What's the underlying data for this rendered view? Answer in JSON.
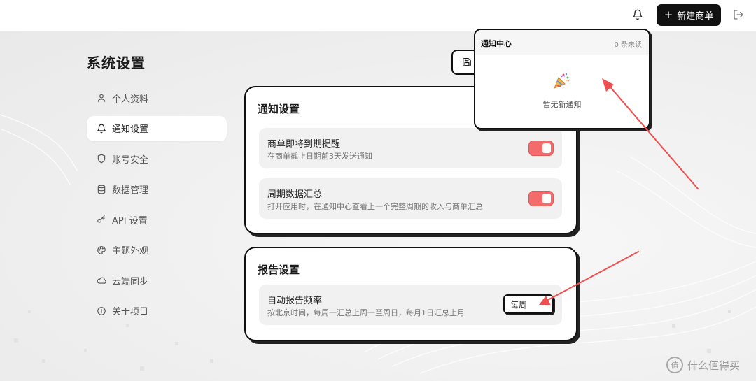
{
  "header": {
    "new_button_label": "新建商单",
    "new_button_icon": "plus-icon",
    "bell_icon": "bell-icon",
    "logout_icon": "logout-icon"
  },
  "page": {
    "title": "系统设置"
  },
  "sidebar": {
    "items": [
      {
        "label": "个人资料",
        "icon": "user-icon",
        "active": false
      },
      {
        "label": "通知设置",
        "icon": "bell-icon",
        "active": true
      },
      {
        "label": "账号安全",
        "icon": "shield-icon",
        "active": false
      },
      {
        "label": "数据管理",
        "icon": "database-icon",
        "active": false
      },
      {
        "label": "API 设置",
        "icon": "key-icon",
        "active": false
      },
      {
        "label": "主题外观",
        "icon": "palette-icon",
        "active": false
      },
      {
        "label": "云端同步",
        "icon": "cloud-icon",
        "active": false
      },
      {
        "label": "关于项目",
        "icon": "info-icon",
        "active": false
      }
    ]
  },
  "notification_card": {
    "title": "通知设置",
    "rows": [
      {
        "title": "商单即将到期提醒",
        "description": "在商单截止日期前3天发送通知",
        "enabled": true
      },
      {
        "title": "周期数据汇总",
        "description": "打开应用时，在通知中心查看上一个完整周期的收入与商单汇总",
        "enabled": true
      }
    ]
  },
  "report_card": {
    "title": "报告设置",
    "rows": [
      {
        "title": "自动报告频率",
        "description": "按北京时间，每周一汇总上周一至周日，每月1日汇总上月",
        "selected": "每周"
      }
    ]
  },
  "notification_popup": {
    "title": "通知中心",
    "unread_count": "0 条未读",
    "empty_icon": "party-popper-icon",
    "empty_text": "暂无新通知"
  },
  "watermark": {
    "text": "什么值得买",
    "logo_char": "值"
  },
  "colors": {
    "accent": "#f36b6b",
    "annotation_arrow": "#ef4f4f",
    "dark": "#111111"
  }
}
